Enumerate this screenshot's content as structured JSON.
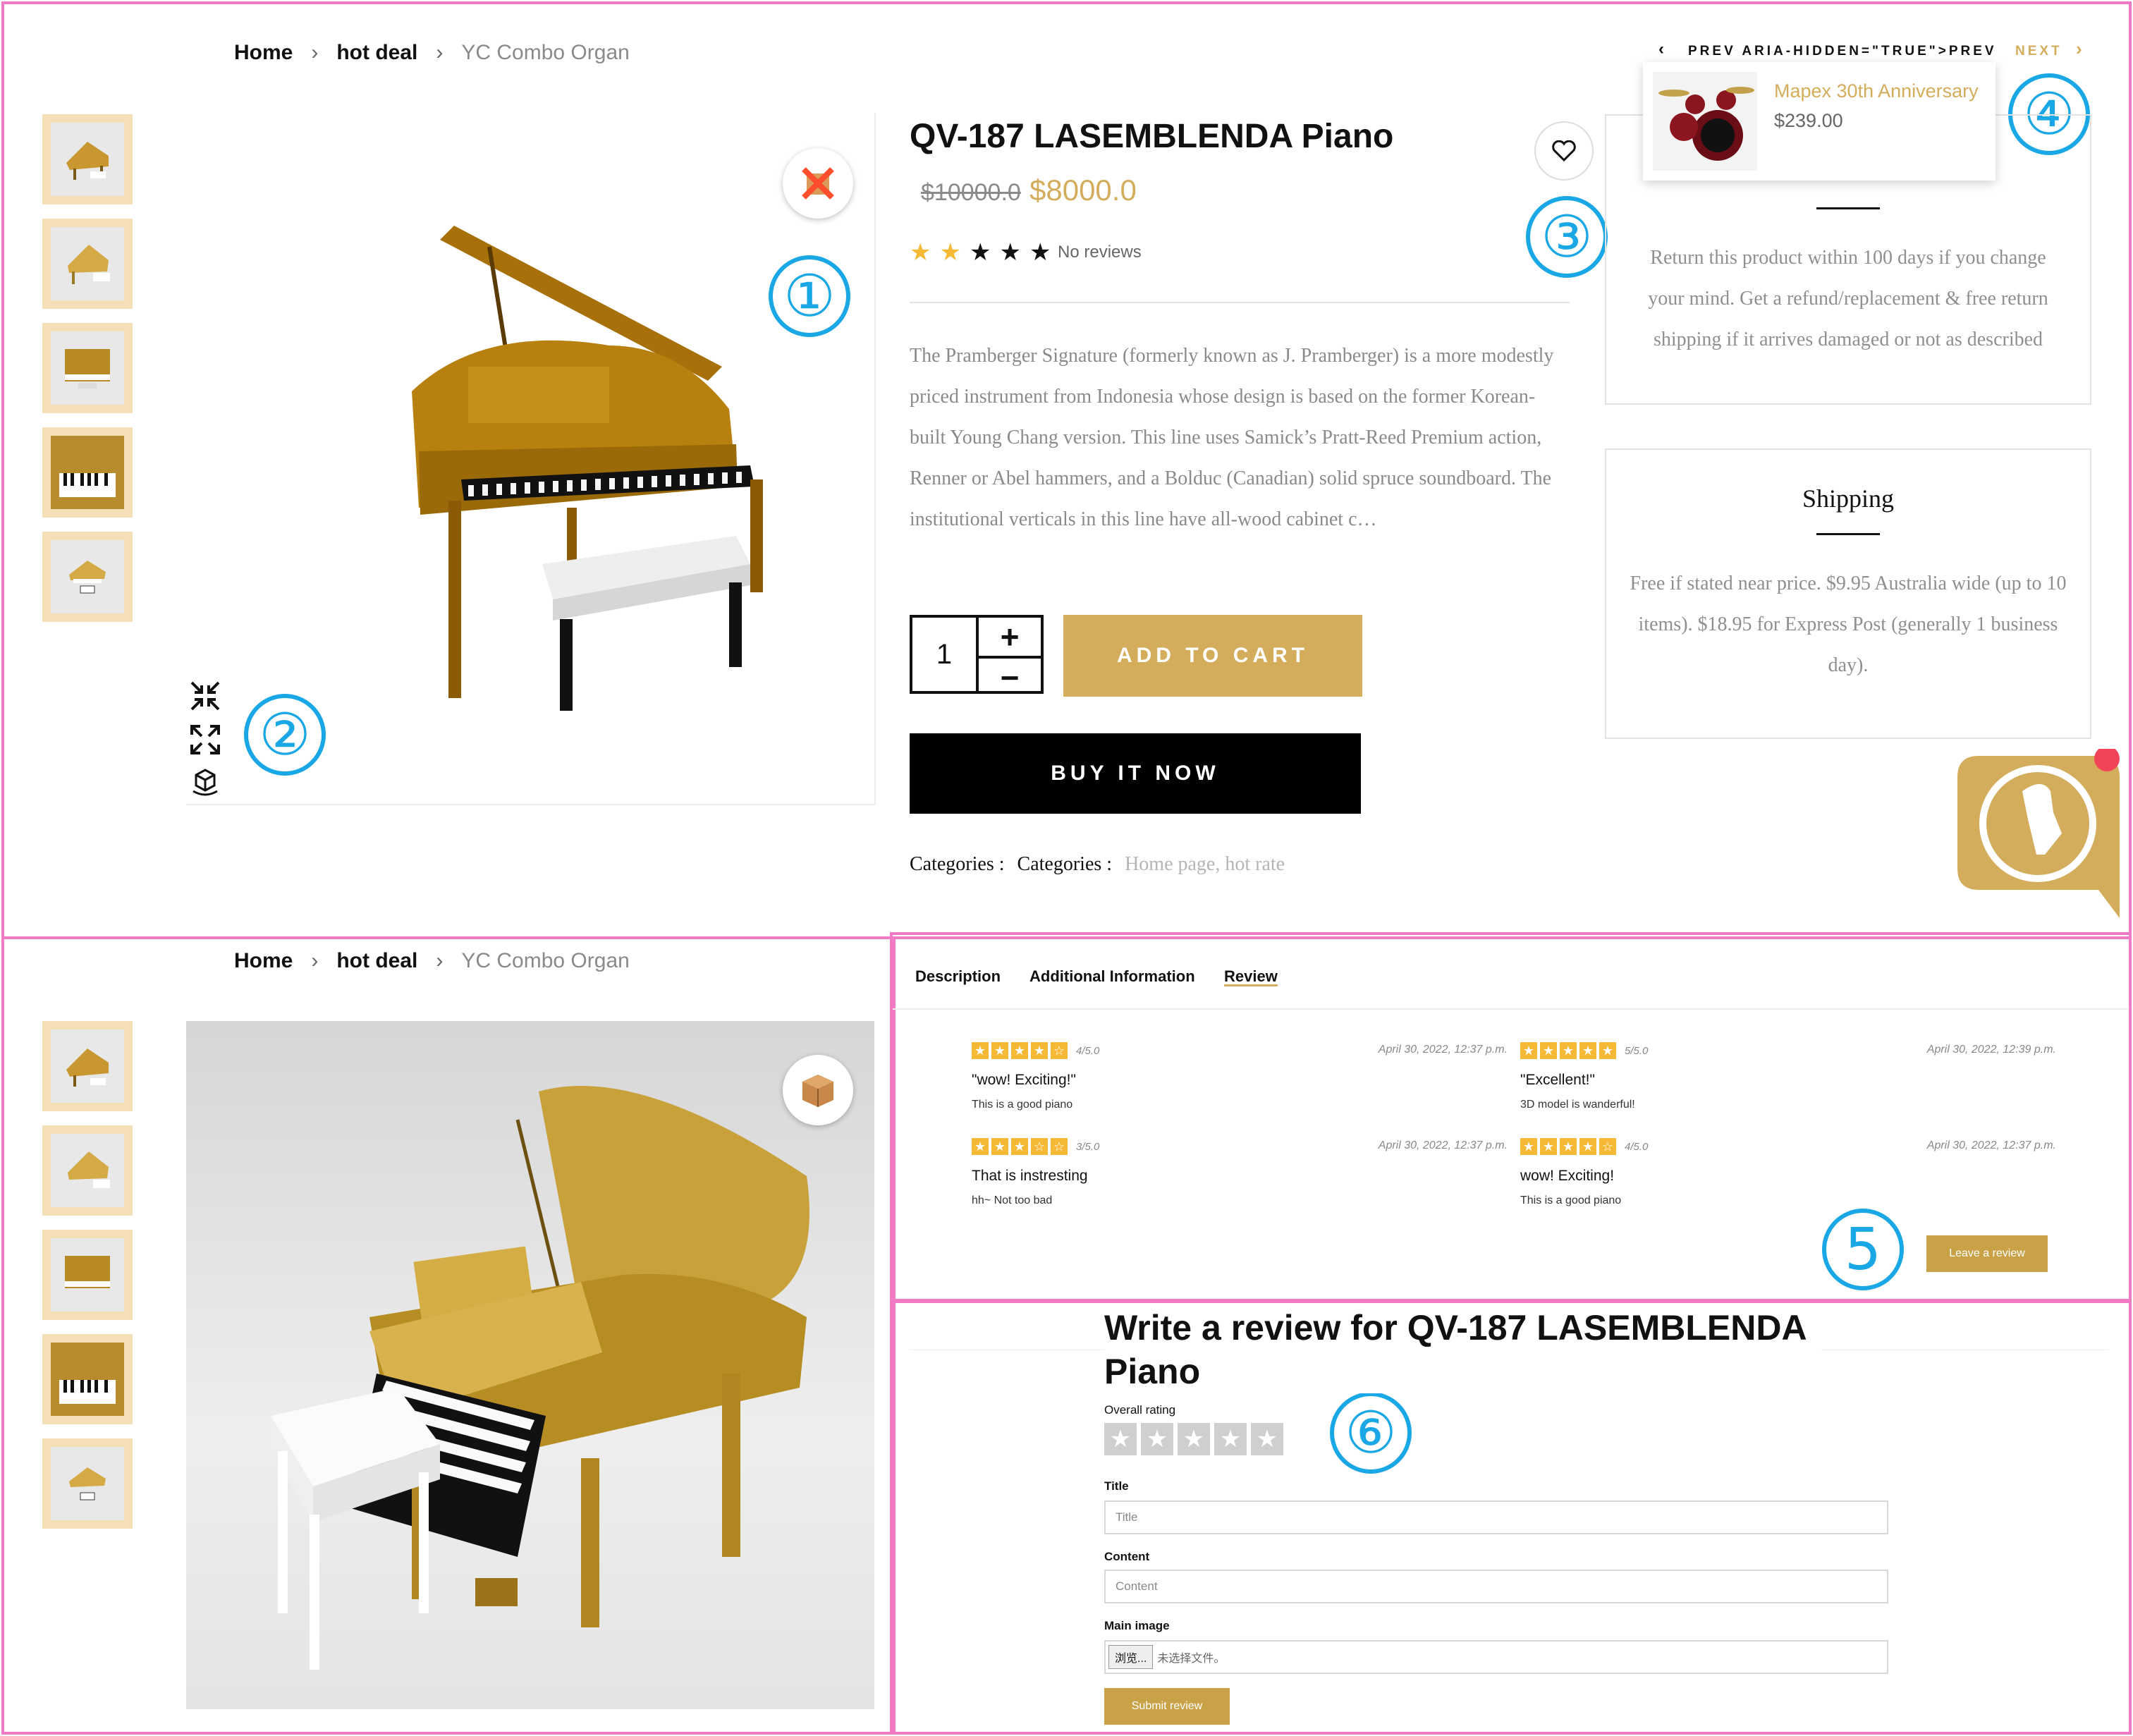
{
  "breadcrumb": {
    "home": "Home",
    "sep": "›",
    "section": "hot deal",
    "current": "YC Combo Organ"
  },
  "product": {
    "title": "QV-187 LASEMBLENDA Piano",
    "old_price": "$10000.0",
    "price": "$8000.0",
    "reviews_label": "No reviews",
    "rating_filled": 2,
    "rating_total": 5,
    "description": "The Pramberger Signature (formerly known as J. Pramberger) is a more modestly priced instrument from Indonesia whose design is based on the former Korean-built Young Chang version. This line uses Samick’s Pratt-Reed Premium action, Renner or Abel hammers, and a Bolduc (Canadian) solid spruce soundboard. The institutional verticals in this line have all-wood cabinet c…",
    "quantity": "1",
    "add_to_cart": "ADD TO CART",
    "buy_now": "BUY IT NOW",
    "categories_label_1": "Categories :",
    "categories_label_2": "Categories :",
    "categories_value": "Home page, hot rate"
  },
  "nav": {
    "prev": "PREV ARIA-HIDDEN=\"TRUE\">PREV",
    "next": "NEXT"
  },
  "popup": {
    "title": "Mapex 30th Anniversary",
    "price": "$239.00"
  },
  "return_box": {
    "text": "Return this product within 100 days if you change your mind. Get a refund/replacement & free return shipping if it arrives damaged or not as described"
  },
  "shipping_box": {
    "title": "Shipping",
    "text": "Free if stated near price. $9.95 Australia wide (up to 10 items). $18.95 for Express Post (generally 1 business day)."
  },
  "badges": [
    "①",
    "②",
    "③",
    "④",
    "5",
    "⑥"
  ],
  "tabs": {
    "description": "Description",
    "additional": "Additional Information",
    "review": "Review"
  },
  "reviews": [
    {
      "score": "4/5.0",
      "date": "April 30, 2022, 12:37 p.m.",
      "title": "\"wow! Exciting!\"",
      "body": "This is a good piano"
    },
    {
      "score": "5/5.0",
      "date": "April 30, 2022, 12:39 p.m.",
      "title": "\"Excellent!\"",
      "body": "3D model is wanderful!"
    },
    {
      "score": "3/5.0",
      "date": "April 30, 2022, 12:37 p.m.",
      "title": "That is instresting",
      "body": "hh~ Not too bad"
    },
    {
      "score": "4/5.0",
      "date": "April 30, 2022, 12:37 p.m.",
      "title": "wow! Exciting!",
      "body": "This is a good piano"
    }
  ],
  "leave_review": "Leave a review",
  "review_form": {
    "heading_line1": "Write a review for QV-187 LASEMBLENDA",
    "heading_line2": "Piano",
    "overall_rating": "Overall rating",
    "title_label": "Title",
    "title_placeholder": "Title",
    "content_label": "Content",
    "content_placeholder": "Content",
    "image_label": "Main image",
    "browse_button": "浏览...",
    "no_file": "未选择文件。",
    "submit": "Submit review"
  },
  "colors": {
    "gold": "#d4ad5c",
    "star": "#f5b935",
    "badge": "#1aa7e6",
    "frame": "#f07ac4"
  }
}
